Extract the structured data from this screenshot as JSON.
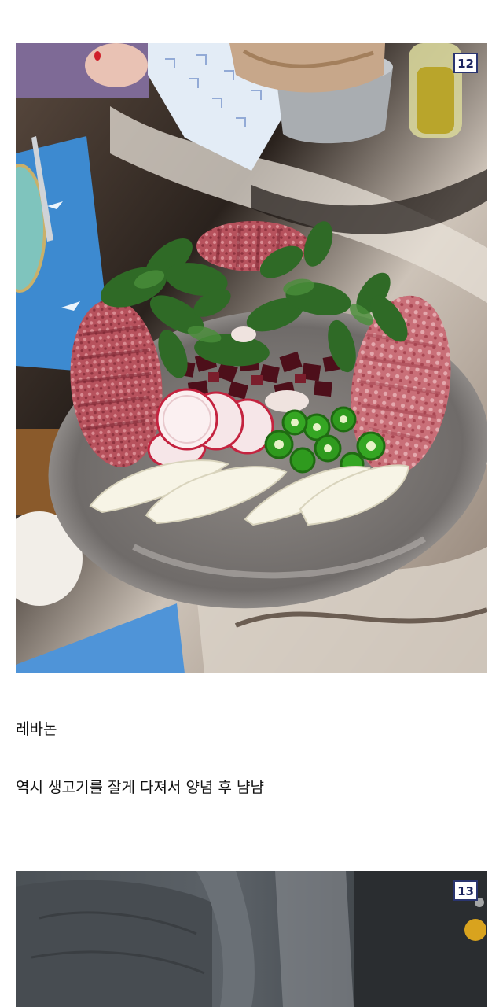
{
  "post": {
    "images": [
      {
        "badge": "12"
      },
      {
        "badge": "13"
      }
    ],
    "caption_title": "레바논",
    "caption_body": "역시 생고기를 잘게 다져서 양념 후 냠냠"
  }
}
